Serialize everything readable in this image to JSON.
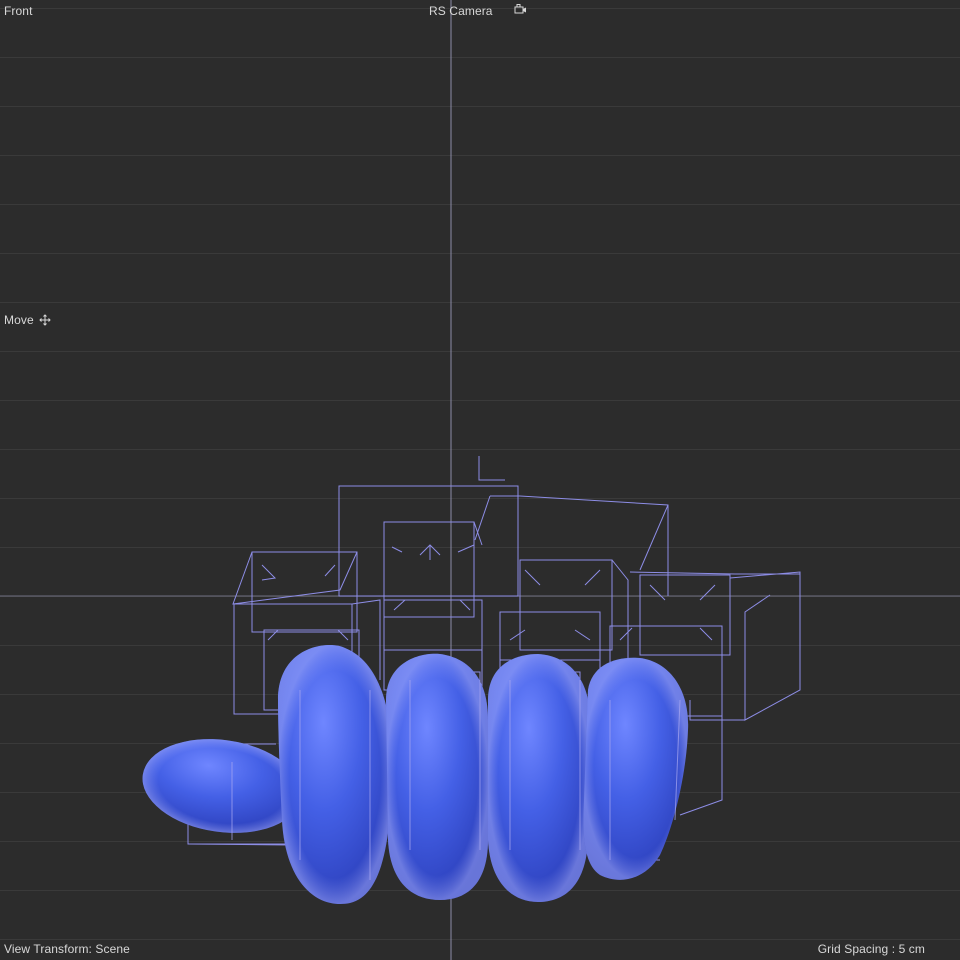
{
  "viewport": {
    "view_name": "Front",
    "camera_name": "RS Camera",
    "camera_icon": "camera-icon",
    "tool_name": "Move",
    "tool_icon": "move-icon",
    "view_transform": "View Transform: Scene",
    "grid_spacing": "Grid Spacing : 5 cm"
  },
  "colors": {
    "background": "#2c2c2c",
    "grid_line": "#3a3a3a",
    "axis_line": "#8c8ca8",
    "wireframe": "#8d8de6",
    "mesh": "#3f5be0",
    "text": "#d8d8d8"
  }
}
